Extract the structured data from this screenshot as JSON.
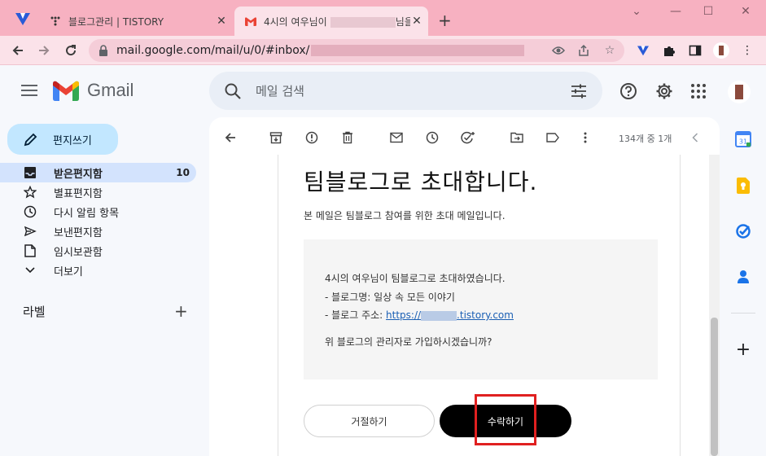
{
  "browser": {
    "tabs": [
      {
        "title": "블로그관리 | TISTORY",
        "active": false
      },
      {
        "title": "4시의 여우님이",
        "title_suffix": "님을",
        "active": true
      }
    ],
    "url": "mail.google.com/mail/u/0/#inbox/"
  },
  "gmail": {
    "brand": "Gmail",
    "search_placeholder": "메일 검색",
    "compose_label": "편지쓰기",
    "nav": [
      {
        "label": "받은편지함",
        "count": "10",
        "icon": "inbox-icon",
        "active": true
      },
      {
        "label": "별표편지함",
        "count": "",
        "icon": "star-icon",
        "active": false
      },
      {
        "label": "다시 알림 항목",
        "count": "",
        "icon": "clock-icon",
        "active": false
      },
      {
        "label": "보낸편지함",
        "count": "",
        "icon": "send-icon",
        "active": false
      },
      {
        "label": "임시보관함",
        "count": "",
        "icon": "draft-icon",
        "active": false
      },
      {
        "label": "더보기",
        "count": "",
        "icon": "chevron-down-icon",
        "active": false
      }
    ],
    "labels_title": "라벨",
    "pager": "134개 중 1개"
  },
  "email": {
    "title": "팀블로그로 초대합니다.",
    "subtitle": "본 메일은 팀블로그 참여를 위한 초대 메일입니다.",
    "line1": "4시의 여우님이 팀블로그로 초대하였습니다.",
    "line2": "- 블로그명: 일상 속 모든 이야기",
    "line3_prefix": "- 블로그 주소: ",
    "link_prefix": "https://",
    "link_suffix": ".tistory.com",
    "line4": "위 블로그의 관리자로 가입하시겠습니까?",
    "decline_label": "거절하기",
    "accept_label": "수락하기"
  },
  "colors": {
    "tabstrip": "#f7b1c1",
    "compose": "#c2e7ff",
    "active_nav": "#d3e3fd",
    "highlight": "#e02020"
  }
}
